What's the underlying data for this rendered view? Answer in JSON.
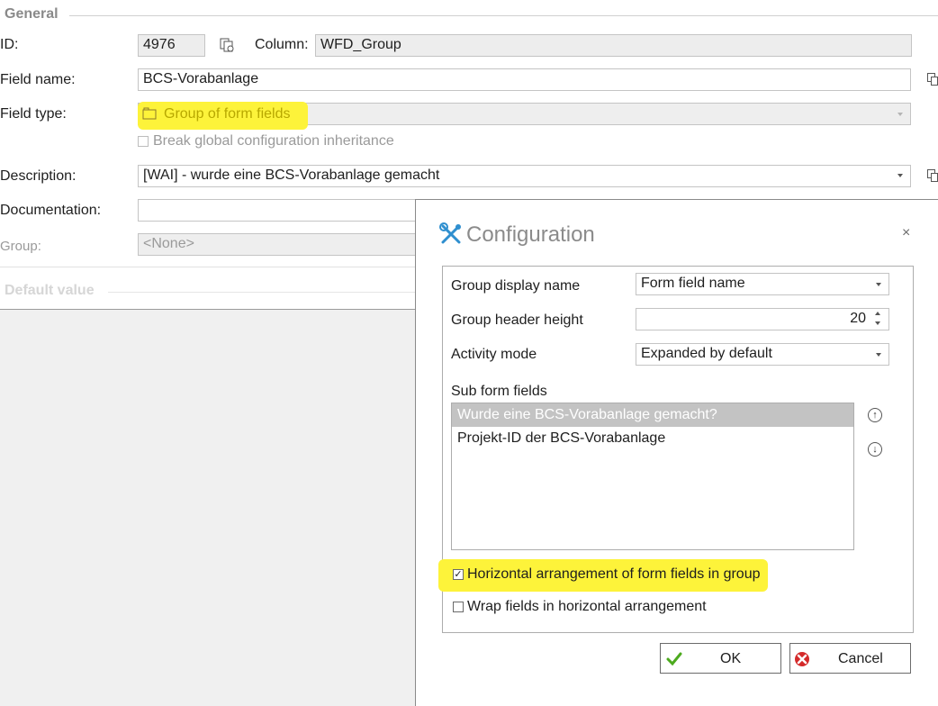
{
  "general": {
    "section_title": "General",
    "id_label": "ID:",
    "id_value": "4976",
    "column_label": "Column:",
    "column_value": "WFD_Group",
    "field_name_label": "Field name:",
    "field_name_value": "BCS-Vorabanlage",
    "field_type_label": "Field type:",
    "field_type_value": "Group of form fields",
    "break_inheritance_label": "Break global configuration inheritance",
    "description_label": "Description:",
    "description_value": "[WAI] - wurde eine BCS-Vorabanlage gemacht",
    "documentation_label": "Documentation:",
    "documentation_value": "",
    "group_label": "Group:",
    "group_value": "<None>"
  },
  "default_value": {
    "section_title": "Default value"
  },
  "dialog": {
    "title": "Configuration",
    "close": "×",
    "group_display_name_label": "Group display name",
    "group_display_name_value": "Form field name",
    "group_header_height_label": "Group header height",
    "group_header_height_value": "20",
    "activity_mode_label": "Activity mode",
    "activity_mode_value": "Expanded by default",
    "sub_form_fields_label": "Sub form fields",
    "sub_form_fields": [
      {
        "label": "Wurde eine BCS-Vorabanlage gemacht?",
        "selected": true
      },
      {
        "label": "Projekt-ID der BCS-Vorabanlage",
        "selected": false
      }
    ],
    "horizontal_label": "Horizontal arrangement of form fields in group",
    "horizontal_checked": true,
    "wrap_label": "Wrap fields in horizontal arrangement",
    "wrap_checked": false,
    "ok_label": "OK",
    "cancel_label": "Cancel"
  },
  "colors": {
    "highlight": "#fdf33a",
    "ok_green": "#4caa1e",
    "cancel_red": "#d42a2a",
    "config_icon_blue": "#2f8fcf"
  }
}
